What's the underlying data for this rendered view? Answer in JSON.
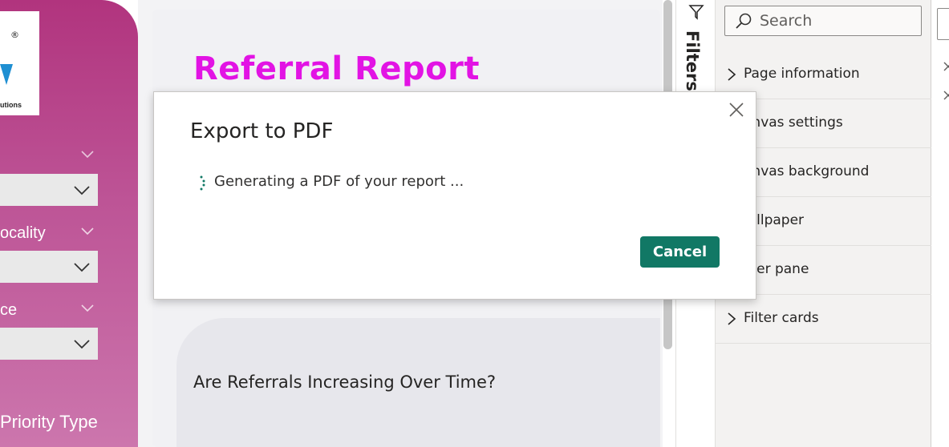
{
  "left_panel": {
    "logo": {
      "registered_mark": "®",
      "subtitle": "utions"
    },
    "slicers": [
      {
        "title": ""
      },
      {
        "title": "ocality"
      },
      {
        "title": "ce"
      },
      {
        "title": "Priority Type"
      }
    ],
    "accent_color": "#b1347e"
  },
  "report": {
    "title": "Referral Report",
    "title_color": "#e213e4",
    "card_title": "Are Referrals Increasing Over Time?"
  },
  "filters_pane": {
    "label": "Filters",
    "icon": "filter-icon"
  },
  "format_pane": {
    "search_placeholder": "Search",
    "sections": [
      {
        "label": "Page information",
        "show_chevron": true
      },
      {
        "label": "anvas settings",
        "show_chevron": false
      },
      {
        "label": "anvas background",
        "show_chevron": false
      },
      {
        "label": "/allpaper",
        "show_chevron": false
      },
      {
        "label": "ilter pane",
        "show_chevron": false
      },
      {
        "label": "Filter cards",
        "show_chevron": true
      }
    ]
  },
  "dialog": {
    "title": "Export to PDF",
    "message": "Generating a PDF of your report ...",
    "cancel_label": "Cancel",
    "cancel_color": "#117865",
    "close_icon": "close-icon"
  }
}
